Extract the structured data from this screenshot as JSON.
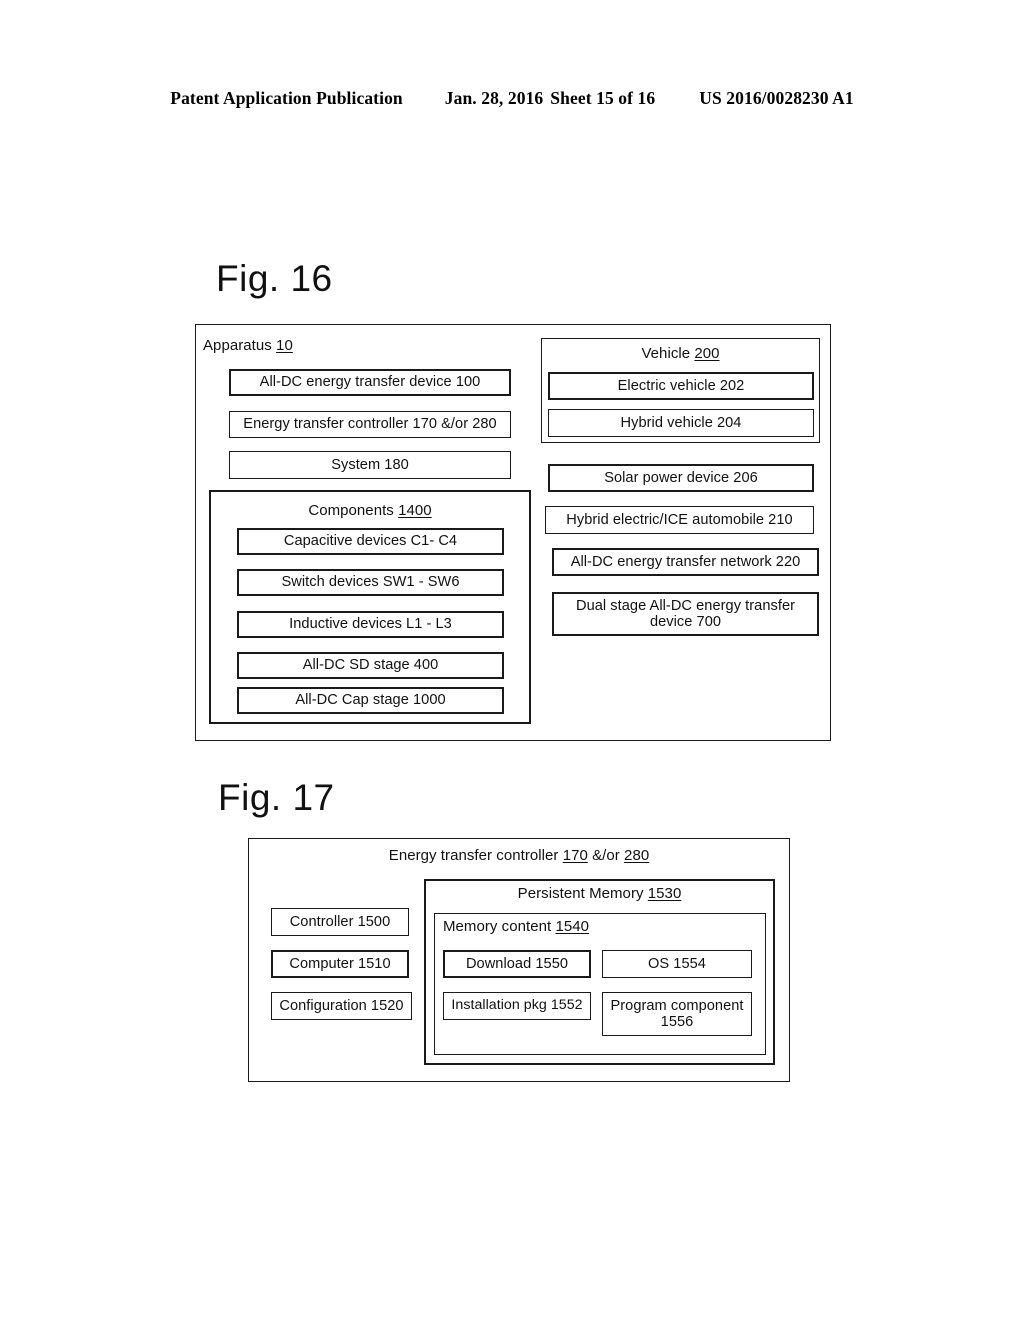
{
  "header": {
    "publication": "Patent Application Publication",
    "date": "Jan. 28, 2016",
    "sheet": "Sheet 15 of 16",
    "number": "US 2016/0028230 A1"
  },
  "figures": [
    {
      "title": "Fig. 16",
      "apparatus": {
        "caption_text": "Apparatus ",
        "caption_ref": "10",
        "items": [
          {
            "label": "All-DC energy transfer device 100"
          },
          {
            "label": "Energy transfer controller 170 &/or 280"
          },
          {
            "label": "System 180"
          }
        ],
        "components_group": {
          "caption_text": "Components  ",
          "caption_ref": "1400",
          "items": [
            {
              "label": "Capacitive devices C1- C4"
            },
            {
              "label": "Switch devices SW1 - SW6"
            },
            {
              "label": "Inductive devices L1 - L3"
            },
            {
              "label": "All-DC SD stage 400"
            },
            {
              "label": "All-DC Cap stage 1000"
            }
          ]
        }
      },
      "right_column": {
        "vehicle_group": {
          "caption_text": "Vehicle ",
          "caption_ref": "200",
          "items": [
            {
              "label": "Electric vehicle 202"
            },
            {
              "label": "Hybrid vehicle 204"
            }
          ]
        },
        "standalone_items": [
          {
            "label": "Solar power device 206"
          },
          {
            "label": "Hybrid electric/ICE automobile 210"
          },
          {
            "label": "All-DC energy transfer network 220"
          },
          {
            "label": "Dual stage All-DC energy transfer device 700"
          }
        ]
      }
    },
    {
      "title": "Fig. 17",
      "controller": {
        "caption_prefix": "Energy transfer controller ",
        "caption_ref1": "170",
        "caption_mid": " &/or ",
        "caption_ref2": "280",
        "left_items": [
          {
            "label": "Controller 1500"
          },
          {
            "label": "Computer 1510"
          },
          {
            "label": "Configuration 1520"
          }
        ],
        "persistent_memory": {
          "caption_text": "Persistent Memory ",
          "caption_ref": "1530",
          "memory_content": {
            "caption_text": "Memory content ",
            "caption_ref": "1540",
            "items": [
              {
                "label": "Download 1550"
              },
              {
                "label": "OS 1554"
              },
              {
                "label": "Installation pkg 1552"
              },
              {
                "label": "Program component 1556"
              }
            ]
          }
        }
      }
    }
  ],
  "colors": {
    "ink": "#1a1a1a",
    "paper": "#ffffff"
  }
}
